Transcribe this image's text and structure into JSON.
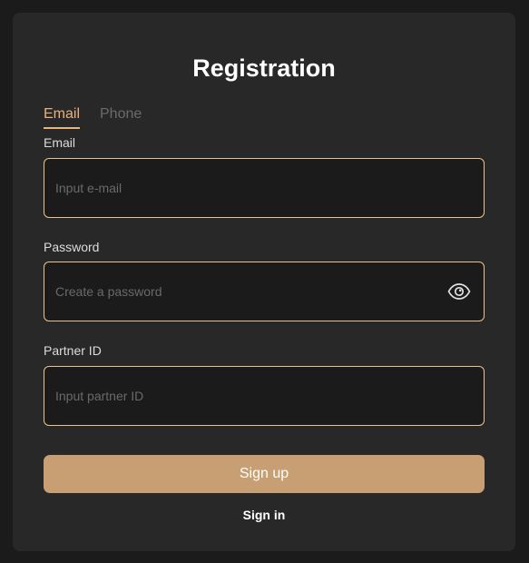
{
  "title": "Registration",
  "tabs": [
    {
      "label": "Email",
      "active": true
    },
    {
      "label": "Phone",
      "active": false
    }
  ],
  "form": {
    "email": {
      "label": "Email",
      "placeholder": "Input e-mail",
      "value": ""
    },
    "password": {
      "label": "Password",
      "placeholder": "Create a password",
      "value": "",
      "toggle_icon": "eye-icon"
    },
    "partner": {
      "label": "Partner ID",
      "placeholder": "Input partner ID",
      "value": ""
    }
  },
  "actions": {
    "signup_label": "Sign up",
    "signin_label": "Sign in"
  },
  "colors": {
    "accent": "#e8b27f",
    "button": "#c89f72",
    "field_border": "#e9c48e",
    "card": "#282828",
    "background": "#1b1b1b"
  }
}
